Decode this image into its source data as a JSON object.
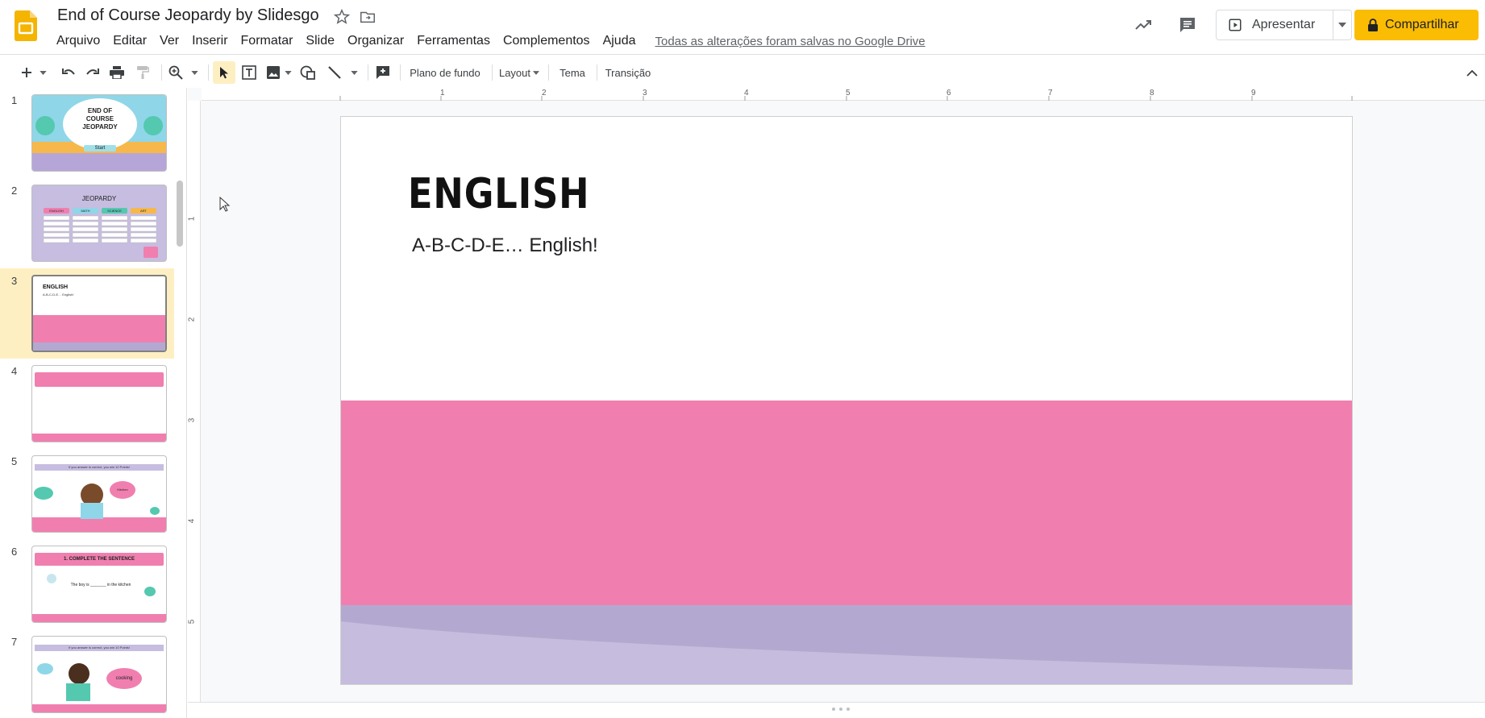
{
  "doc": {
    "title": "End of Course Jeopardy by Slidesgo",
    "save_status": "Todas as alterações foram salvas no Google Drive"
  },
  "menu": [
    "Arquivo",
    "Editar",
    "Ver",
    "Inserir",
    "Formatar",
    "Slide",
    "Organizar",
    "Ferramentas",
    "Complementos",
    "Ajuda"
  ],
  "header_buttons": {
    "present": "Apresentar",
    "share": "Compartilhar"
  },
  "toolbar": {
    "background": "Plano de fundo",
    "layout": "Layout",
    "theme": "Tema",
    "transition": "Transição"
  },
  "filmstrip": {
    "slides": [
      {
        "num": "1",
        "title": "END OF COURSE JEOPARDY",
        "button": "Start"
      },
      {
        "num": "2",
        "title": "JEOPARDY",
        "columns": [
          "ENGLISH",
          "MATH",
          "SCIENCE",
          "ART"
        ]
      },
      {
        "num": "3",
        "title": "ENGLISH",
        "subtitle": "A-B-C-D-E… English!"
      },
      {
        "num": "4"
      },
      {
        "num": "5",
        "banner": "If you answer is correct, you win 10 Points!",
        "bubble": "Kitchen"
      },
      {
        "num": "6",
        "banner": "1. COMPLETE THE SENTENCE",
        "sentence": "The boy is _______ in the kitchen"
      },
      {
        "num": "7",
        "banner": "If you answer is correct, you win 10 Points!",
        "bubble": "cooking"
      }
    ],
    "selected_index": 2
  },
  "ruler": {
    "top_ticks": [
      "1",
      "2",
      "3",
      "4",
      "5",
      "6",
      "7",
      "8",
      "9"
    ],
    "left_ticks": [
      "1",
      "2",
      "3",
      "4",
      "5"
    ]
  },
  "slide": {
    "title": "ENGLISH",
    "subtitle": "A-B-C-D-E… English!"
  },
  "colors": {
    "accent_yellow": "#fbbc04",
    "slide_pink": "#f07faf",
    "slide_lavender": "#b3a9d0",
    "selection": "#feefc3"
  }
}
